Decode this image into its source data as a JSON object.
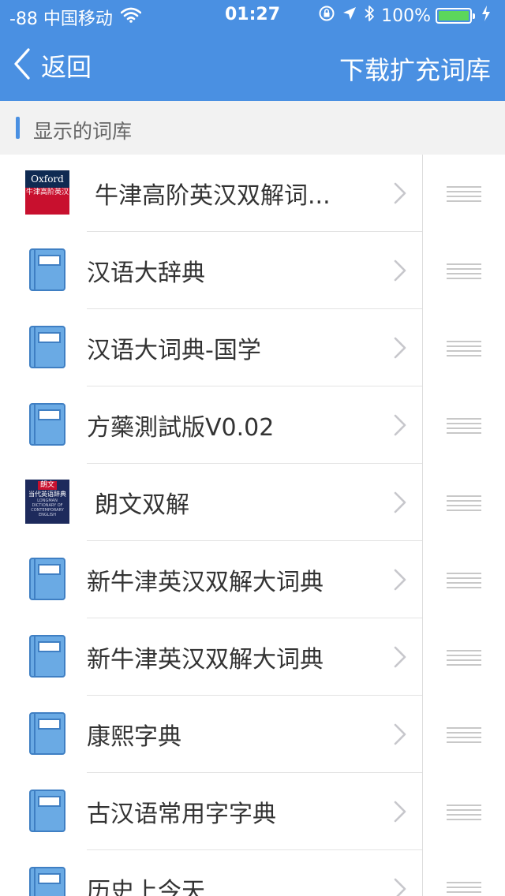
{
  "status_bar": {
    "carrier": "-88 中国移动",
    "time": "01:27",
    "battery": "100%"
  },
  "nav": {
    "back_label": "返回",
    "action_label": "下载扩充词库"
  },
  "section": {
    "title": "显示的词库"
  },
  "covers": {
    "oxford_brand": "Oxford",
    "oxford_subtitle": "牛津高阶英汉",
    "longman_brand": "朗文",
    "longman_subtitle": "当代英语辞典",
    "longman_caption": "LONGMAN DICTIONARY OF CONTEMPORARY ENGLISH"
  },
  "dictionaries": [
    {
      "name": "牛津高阶英汉双解词...",
      "icon": "oxford-cover"
    },
    {
      "name": "汉语大辞典",
      "icon": "book-icon"
    },
    {
      "name": "汉语大词典-国学",
      "icon": "book-icon"
    },
    {
      "name": "方藥測試版V0.02",
      "icon": "book-icon"
    },
    {
      "name": "朗文双解",
      "icon": "longman-cover"
    },
    {
      "name": "新牛津英汉双解大词典",
      "icon": "book-icon"
    },
    {
      "name": "新牛津英汉双解大词典",
      "icon": "book-icon"
    },
    {
      "name": "康熙字典",
      "icon": "book-icon"
    },
    {
      "name": "古汉语常用字字典",
      "icon": "book-icon"
    },
    {
      "name": "历史上今天",
      "icon": "book-icon"
    }
  ],
  "colors": {
    "brand_blue": "#4a90e2",
    "book_fill": "#6aaae4",
    "battery_green": "#5cd65c"
  }
}
